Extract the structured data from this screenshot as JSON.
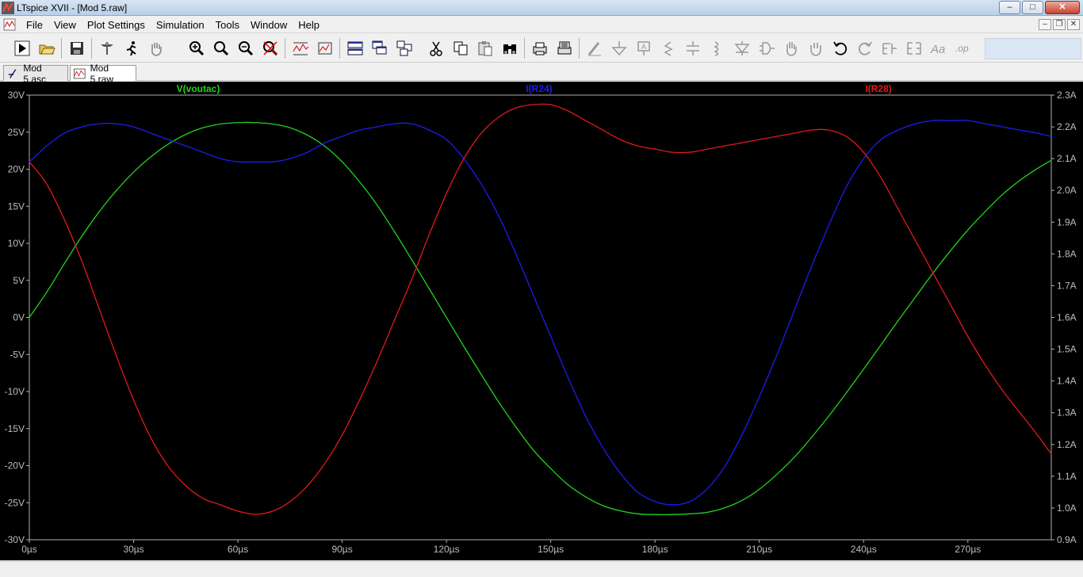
{
  "window": {
    "title": "LTspice XVII - [Mod 5.raw]"
  },
  "menu": [
    "File",
    "View",
    "Plot Settings",
    "Simulation",
    "Tools",
    "Window",
    "Help"
  ],
  "window_buttons": {
    "minimize": "–",
    "maximize": "□",
    "close": "✕"
  },
  "mdi_buttons": {
    "minimize": "–",
    "restore": "❐",
    "close": "✕"
  },
  "toolbar": {
    "icons": [
      "run-icon",
      "open-icon",
      "save-icon",
      "control-panel-icon",
      "halt-icon",
      "pan-icon",
      "zoom-in-icon",
      "zoom-area-icon",
      "zoom-out-icon",
      "zoom-cancel-icon",
      "autorange-icon",
      "manual-range-icon",
      "tile-horizontal-icon",
      "cascade-icon",
      "tile-windows-icon",
      "cut-icon",
      "copy-icon",
      "paste-icon",
      "find-icon",
      "print-icon",
      "print-setup-icon",
      "wire-icon",
      "ground-icon",
      "label-net-icon",
      "resistor-icon",
      "capacitor-icon",
      "inductor-icon",
      "diode-icon",
      "component-icon",
      "move-icon",
      "drag-icon",
      "undo-icon",
      "redo-icon",
      "rotate-icon",
      "mirror-icon",
      "text-icon",
      "spice-directive-icon"
    ]
  },
  "tabs": [
    {
      "label": "Mod 5.asc",
      "icon": "schematic-icon",
      "active": false
    },
    {
      "label": "Mod 5.raw",
      "icon": "waveform-icon",
      "active": true
    }
  ],
  "colors": {
    "plot_bg": "#000000",
    "axis": "#aaaaaa",
    "label": "#bdbdbd",
    "v": "#22d41b",
    "ir24": "#1d1df0",
    "ir28": "#e01a1a"
  },
  "chart_data": {
    "type": "line",
    "x_unit": "µs",
    "xlim": [
      0,
      294
    ],
    "x_ticks": [
      0,
      30,
      60,
      90,
      120,
      150,
      180,
      210,
      240,
      270
    ],
    "x_tick_labels": [
      "0µs",
      "30µs",
      "60µs",
      "90µs",
      "120µs",
      "150µs",
      "180µs",
      "210µs",
      "240µs",
      "270µs"
    ],
    "y_left": {
      "lim": [
        -30,
        30
      ],
      "ticks": [
        30,
        25,
        20,
        15,
        10,
        5,
        0,
        -5,
        -10,
        -15,
        -20,
        -25,
        -30
      ],
      "tick_labels": [
        "30V",
        "25V",
        "20V",
        "15V",
        "10V",
        "5V",
        "0V",
        "-5V",
        "-10V",
        "-15V",
        "-20V",
        "-25V",
        "-30V"
      ]
    },
    "y_right": {
      "lim": [
        0.9,
        2.3
      ],
      "ticks": [
        2.3,
        2.2,
        2.1,
        2.0,
        1.9,
        1.8,
        1.7,
        1.6,
        1.5,
        1.4,
        1.3,
        1.2,
        1.1,
        1.0,
        0.9
      ],
      "tick_labels": [
        "2.3A",
        "2.2A",
        "2.1A",
        "2.0A",
        "1.9A",
        "1.8A",
        "1.7A",
        "1.6A",
        "1.5A",
        "1.4A",
        "1.3A",
        "1.2A",
        "1.1A",
        "1.0A",
        "0.9A"
      ]
    },
    "grid": false,
    "series": [
      {
        "name": "V(voutac)",
        "axis": "left",
        "color": "#22d41b",
        "x": [
          0,
          5,
          10,
          15,
          20,
          25,
          30,
          35,
          40,
          45,
          50,
          55,
          60,
          65,
          70,
          75,
          80,
          85,
          90,
          95,
          100,
          105,
          110,
          115,
          120,
          125,
          130,
          135,
          140,
          145,
          150,
          155,
          160,
          165,
          170,
          175,
          180,
          185,
          190,
          195,
          200,
          205,
          210,
          215,
          220,
          225,
          230,
          235,
          240,
          245,
          250,
          255,
          260,
          265,
          270,
          275,
          280,
          285,
          290,
          294
        ],
        "y": [
          0.0,
          3.4,
          7.2,
          10.9,
          14.2,
          17.1,
          19.6,
          21.7,
          23.4,
          24.7,
          25.6,
          26.1,
          26.3,
          26.3,
          26.1,
          25.6,
          24.6,
          23.1,
          21.0,
          18.3,
          15.2,
          11.6,
          7.8,
          3.9,
          0.0,
          -3.9,
          -7.7,
          -11.4,
          -14.8,
          -17.9,
          -20.4,
          -22.6,
          -24.2,
          -25.4,
          -26.1,
          -26.5,
          -26.6,
          -26.6,
          -26.5,
          -26.3,
          -25.7,
          -24.7,
          -23.2,
          -21.2,
          -18.9,
          -16.2,
          -13.3,
          -10.2,
          -7.0,
          -3.7,
          -0.4,
          2.8,
          6.0,
          9.0,
          11.8,
          14.3,
          16.6,
          18.5,
          20.1,
          21.2
        ]
      },
      {
        "name": "I(R24)",
        "axis": "right",
        "color": "#1d1df0",
        "x": [
          0,
          5,
          10,
          15,
          20,
          25,
          30,
          35,
          40,
          45,
          50,
          55,
          60,
          65,
          70,
          75,
          80,
          85,
          90,
          95,
          100,
          105,
          110,
          115,
          120,
          125,
          130,
          135,
          140,
          145,
          150,
          155,
          160,
          165,
          170,
          175,
          180,
          185,
          190,
          195,
          200,
          205,
          210,
          215,
          220,
          225,
          230,
          235,
          240,
          245,
          250,
          255,
          260,
          265,
          270,
          275,
          280,
          285,
          290,
          294
        ],
        "y": [
          2.09,
          2.14,
          2.18,
          2.2,
          2.21,
          2.21,
          2.2,
          2.18,
          2.16,
          2.14,
          2.12,
          2.1,
          2.09,
          2.09,
          2.09,
          2.1,
          2.12,
          2.15,
          2.17,
          2.19,
          2.2,
          2.21,
          2.21,
          2.19,
          2.16,
          2.1,
          2.02,
          1.92,
          1.8,
          1.67,
          1.54,
          1.41,
          1.29,
          1.19,
          1.11,
          1.05,
          1.02,
          1.01,
          1.02,
          1.06,
          1.13,
          1.23,
          1.35,
          1.48,
          1.62,
          1.76,
          1.89,
          2.01,
          2.1,
          2.16,
          2.19,
          2.21,
          2.22,
          2.22,
          2.22,
          2.21,
          2.2,
          2.19,
          2.18,
          2.17
        ]
      },
      {
        "name": "I(R28)",
        "axis": "right",
        "color": "#e01a1a",
        "x": [
          0,
          5,
          10,
          15,
          20,
          25,
          30,
          35,
          40,
          45,
          50,
          55,
          60,
          65,
          70,
          75,
          80,
          85,
          90,
          95,
          100,
          105,
          110,
          115,
          120,
          125,
          130,
          135,
          140,
          145,
          150,
          155,
          160,
          165,
          170,
          175,
          180,
          185,
          190,
          195,
          200,
          205,
          210,
          215,
          220,
          225,
          230,
          235,
          240,
          245,
          250,
          255,
          260,
          265,
          270,
          275,
          280,
          285,
          290,
          294
        ],
        "y": [
          2.09,
          2.02,
          1.91,
          1.78,
          1.63,
          1.48,
          1.34,
          1.22,
          1.13,
          1.07,
          1.03,
          1.01,
          0.99,
          0.98,
          0.99,
          1.02,
          1.07,
          1.14,
          1.23,
          1.34,
          1.46,
          1.59,
          1.72,
          1.86,
          1.99,
          2.1,
          2.18,
          2.23,
          2.26,
          2.27,
          2.27,
          2.25,
          2.22,
          2.19,
          2.16,
          2.14,
          2.13,
          2.12,
          2.12,
          2.13,
          2.14,
          2.15,
          2.16,
          2.17,
          2.18,
          2.19,
          2.19,
          2.17,
          2.12,
          2.04,
          1.94,
          1.84,
          1.74,
          1.64,
          1.54,
          1.45,
          1.37,
          1.3,
          1.23,
          1.17
        ]
      }
    ]
  }
}
